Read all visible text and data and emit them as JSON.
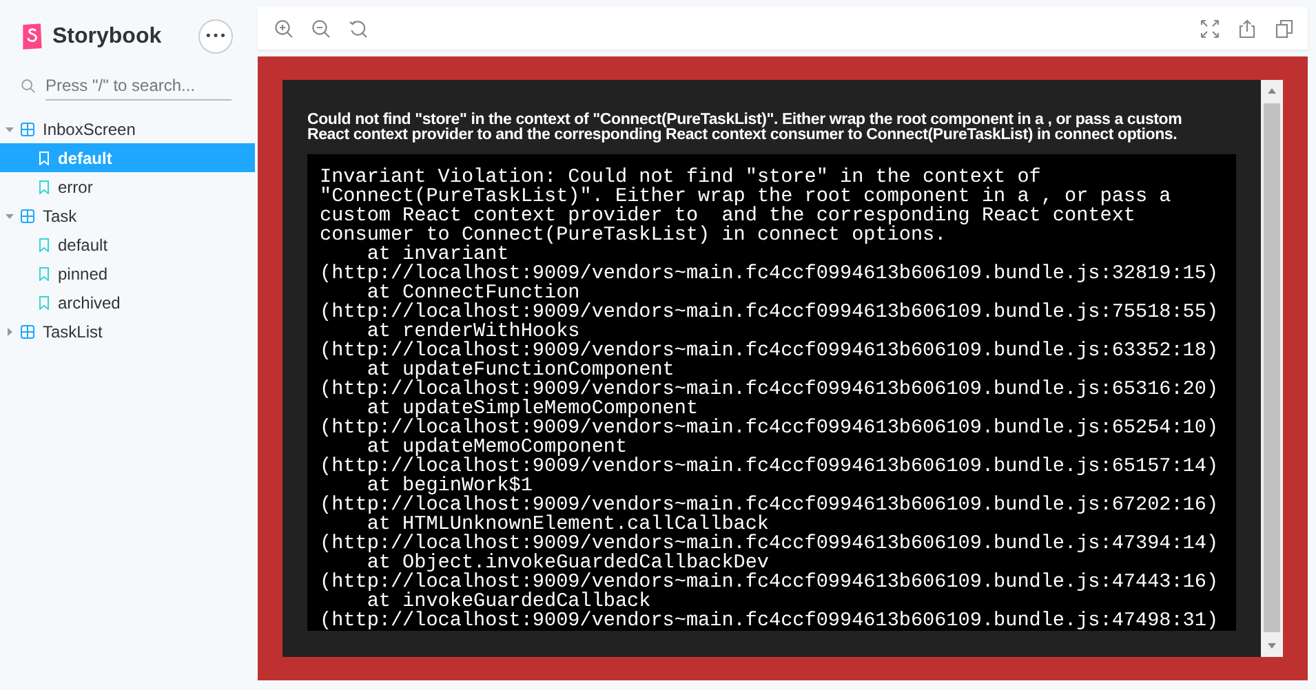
{
  "brand": {
    "name": "Storybook"
  },
  "menu_button": {
    "label": "•••"
  },
  "search": {
    "placeholder": "Press \"/\" to search..."
  },
  "tree": [
    {
      "label": "InboxScreen",
      "expanded": true,
      "children": [
        {
          "label": "default",
          "selected": true
        },
        {
          "label": "error",
          "selected": false
        }
      ]
    },
    {
      "label": "Task",
      "expanded": true,
      "children": [
        {
          "label": "default",
          "selected": false
        },
        {
          "label": "pinned",
          "selected": false
        },
        {
          "label": "archived",
          "selected": false
        }
      ]
    },
    {
      "label": "TaskList",
      "expanded": false
    }
  ],
  "error": {
    "heading": "Could not find \"store\" in the context of \"Connect(PureTaskList)\". Either wrap the root component in a , or pass a custom React context provider to  and the corresponding React context consumer to Connect(PureTaskList) in connect options.",
    "message": "Invariant Violation: Could not find \"store\" in the context of \"Connect(PureTaskList)\". Either wrap the root component in a , or pass a custom React context provider to  and the corresponding React context consumer to Connect(PureTaskList) in connect options.",
    "stack": [
      {
        "call": "at invariant",
        "location": "(http://localhost:9009/vendors~main.fc4ccf0994613b606109.bundle.js:32819:15)"
      },
      {
        "call": "at ConnectFunction",
        "location": "(http://localhost:9009/vendors~main.fc4ccf0994613b606109.bundle.js:75518:55)"
      },
      {
        "call": "at renderWithHooks",
        "location": "(http://localhost:9009/vendors~main.fc4ccf0994613b606109.bundle.js:63352:18)"
      },
      {
        "call": "at updateFunctionComponent",
        "location": "(http://localhost:9009/vendors~main.fc4ccf0994613b606109.bundle.js:65316:20)"
      },
      {
        "call": "at updateSimpleMemoComponent",
        "location": "(http://localhost:9009/vendors~main.fc4ccf0994613b606109.bundle.js:65254:10)"
      },
      {
        "call": "at updateMemoComponent",
        "location": "(http://localhost:9009/vendors~main.fc4ccf0994613b606109.bundle.js:65157:14)"
      },
      {
        "call": "at beginWork$1",
        "location": "(http://localhost:9009/vendors~main.fc4ccf0994613b606109.bundle.js:67202:16)"
      },
      {
        "call": "at HTMLUnknownElement.callCallback",
        "location": "(http://localhost:9009/vendors~main.fc4ccf0994613b606109.bundle.js:47394:14)"
      },
      {
        "call": "at Object.invokeGuardedCallbackDev",
        "location": "(http://localhost:9009/vendors~main.fc4ccf0994613b606109.bundle.js:47443:16)"
      },
      {
        "call": "at invokeGuardedCallback",
        "location": "(http://localhost:9009/vendors~main.fc4ccf0994613b606109.bundle.js:47498:31)"
      }
    ]
  }
}
